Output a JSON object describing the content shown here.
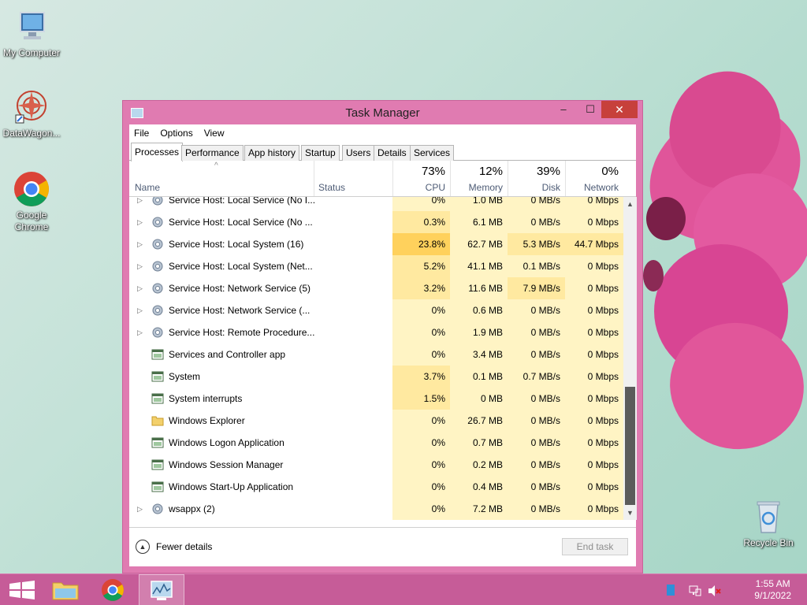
{
  "desktop": {
    "icons": [
      {
        "label": "My Computer"
      },
      {
        "label": "DataWagon..."
      },
      {
        "label": "Google Chrome"
      },
      {
        "label": "Recycle Bin"
      }
    ]
  },
  "window": {
    "title": "Task Manager",
    "controls": {
      "minimize": "–",
      "maximize": "☐",
      "close": "✕"
    },
    "menu": [
      "File",
      "Options",
      "View"
    ],
    "tabs": [
      "Processes",
      "Performance",
      "App history",
      "Startup",
      "Users",
      "Details",
      "Services"
    ],
    "active_tab": "Processes",
    "columns": {
      "name": "Name",
      "status": "Status",
      "cpu": {
        "pct": "73%",
        "label": "CPU"
      },
      "memory": {
        "pct": "12%",
        "label": "Memory"
      },
      "disk": {
        "pct": "39%",
        "label": "Disk"
      },
      "network": {
        "pct": "0%",
        "label": "Network"
      }
    },
    "rows": [
      {
        "name": "Service Host: Local Service (No I...",
        "cpu": "0%",
        "mem": "1.0 MB",
        "disk": "0 MB/s",
        "net": "0 Mbps",
        "expandable": true,
        "icon": "gear-icon"
      },
      {
        "name": "Service Host: Local Service (No ...",
        "cpu": "0.3%",
        "mem": "6.1 MB",
        "disk": "0 MB/s",
        "net": "0 Mbps",
        "expandable": true,
        "icon": "gear-icon"
      },
      {
        "name": "Service Host: Local System (16)",
        "cpu": "23.8%",
        "mem": "62.7 MB",
        "disk": "5.3 MB/s",
        "net": "44.7 Mbps",
        "expandable": true,
        "icon": "gear-icon"
      },
      {
        "name": "Service Host: Local System (Net...",
        "cpu": "5.2%",
        "mem": "41.1 MB",
        "disk": "0.1 MB/s",
        "net": "0 Mbps",
        "expandable": true,
        "icon": "gear-icon"
      },
      {
        "name": "Service Host: Network Service (5)",
        "cpu": "3.2%",
        "mem": "11.6 MB",
        "disk": "7.9 MB/s",
        "net": "0 Mbps",
        "expandable": true,
        "icon": "gear-icon"
      },
      {
        "name": "Service Host: Network Service (...",
        "cpu": "0%",
        "mem": "0.6 MB",
        "disk": "0 MB/s",
        "net": "0 Mbps",
        "expandable": true,
        "icon": "gear-icon"
      },
      {
        "name": "Service Host: Remote Procedure...",
        "cpu": "0%",
        "mem": "1.9 MB",
        "disk": "0 MB/s",
        "net": "0 Mbps",
        "expandable": true,
        "icon": "gear-icon"
      },
      {
        "name": "Services and Controller app",
        "cpu": "0%",
        "mem": "3.4 MB",
        "disk": "0 MB/s",
        "net": "0 Mbps",
        "expandable": false,
        "icon": "app-window-icon"
      },
      {
        "name": "System",
        "cpu": "3.7%",
        "mem": "0.1 MB",
        "disk": "0.7 MB/s",
        "net": "0 Mbps",
        "expandable": false,
        "icon": "app-window-icon"
      },
      {
        "name": "System interrupts",
        "cpu": "1.5%",
        "mem": "0 MB",
        "disk": "0 MB/s",
        "net": "0 Mbps",
        "expandable": false,
        "icon": "app-window-icon"
      },
      {
        "name": "Windows Explorer",
        "cpu": "0%",
        "mem": "26.7 MB",
        "disk": "0 MB/s",
        "net": "0 Mbps",
        "expandable": false,
        "icon": "folder-icon"
      },
      {
        "name": "Windows Logon Application",
        "cpu": "0%",
        "mem": "0.7 MB",
        "disk": "0 MB/s",
        "net": "0 Mbps",
        "expandable": false,
        "icon": "app-window-icon"
      },
      {
        "name": "Windows Session Manager",
        "cpu": "0%",
        "mem": "0.2 MB",
        "disk": "0 MB/s",
        "net": "0 Mbps",
        "expandable": false,
        "icon": "app-window-icon"
      },
      {
        "name": "Windows Start-Up Application",
        "cpu": "0%",
        "mem": "0.4 MB",
        "disk": "0 MB/s",
        "net": "0 Mbps",
        "expandable": false,
        "icon": "app-window-icon"
      },
      {
        "name": "wsappx (2)",
        "cpu": "0%",
        "mem": "7.2 MB",
        "disk": "0 MB/s",
        "net": "0 Mbps",
        "expandable": true,
        "icon": "gear-icon"
      }
    ],
    "footer": {
      "fewer_details": "Fewer details",
      "end_task": "End task"
    }
  },
  "taskbar": {
    "items": [
      "start-button",
      "file-explorer",
      "google-chrome",
      "task-manager"
    ],
    "clock": {
      "time": "1:55 AM",
      "date": "9/1/2022"
    }
  },
  "colors": {
    "window_frame": "#e07bb1",
    "taskbar": "#c65c98",
    "close_button": "#c7403b",
    "heat_low": "#fff4c4",
    "heat_mid": "#ffe9a0",
    "heat_high": "#ffd15c"
  }
}
